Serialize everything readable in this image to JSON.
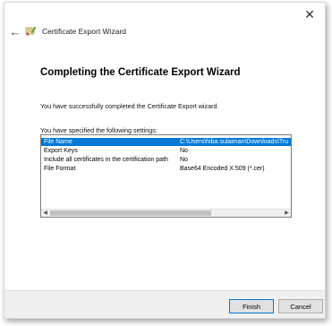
{
  "wizard": {
    "title": "Certificate Export Wizard",
    "heading": "Completing the Certificate Export Wizard",
    "success_message": "You have successfully completed the Certificate Export wizard.",
    "settings_intro": "You have specified the following settings:"
  },
  "settings": [
    {
      "name": "File Name",
      "value": "C:\\Users\\hiba.sulaiman\\Downloads\\Tru",
      "selected": true
    },
    {
      "name": "Export Keys",
      "value": "No",
      "selected": false
    },
    {
      "name": "Include all certificates in the certification path",
      "value": "No",
      "selected": false
    },
    {
      "name": "File Format",
      "value": "Base64 Encoded X.509 (*.cer)",
      "selected": false
    }
  ],
  "buttons": {
    "finish": "Finish",
    "cancel": "Cancel"
  },
  "icons": {
    "close": "close-icon",
    "back": "back-arrow-icon",
    "wizard": "certificate-wizard-icon",
    "scroll_left": "scroll-left-icon",
    "scroll_right": "scroll-right-icon"
  },
  "colors": {
    "selection": "#0078d7",
    "footer": "#f0f0f0"
  }
}
